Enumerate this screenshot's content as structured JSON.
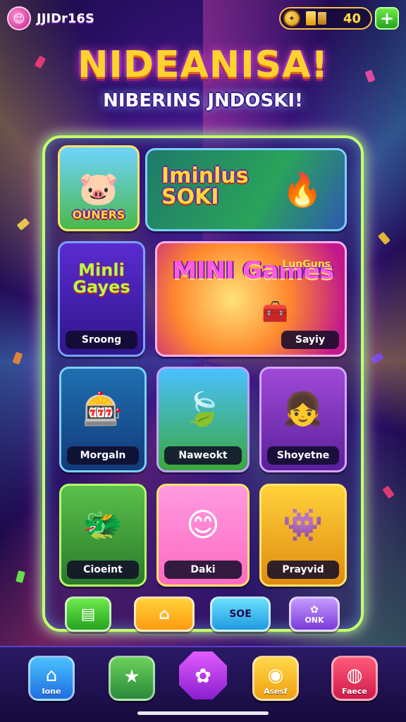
{
  "app": {
    "name": "JJIDr16S",
    "avatar_icon": "smiley-icon"
  },
  "currency": {
    "value": "40",
    "add_icon": "+"
  },
  "title": "NIDEANISA!",
  "subtitle": "NIBERINS JNDOSKI!",
  "tiles": [
    {
      "id": "tile-1",
      "heading": "OUNERS",
      "label": ""
    },
    {
      "id": "tile-2",
      "heading": "Iminlus SOKI",
      "label": ""
    },
    {
      "id": "tile-3",
      "heading": "Minli Gayes",
      "label": "Sroong"
    },
    {
      "id": "tile-4",
      "heading": "MINI Games",
      "label": "Sayiy",
      "badge": "LunGuns"
    },
    {
      "id": "tile-5",
      "heading": "",
      "label": "Morgaln"
    },
    {
      "id": "tile-6",
      "heading": "",
      "label": "Naweokt"
    },
    {
      "id": "tile-7",
      "heading": "",
      "label": "Shoyetne"
    },
    {
      "id": "tile-8",
      "heading": "",
      "label": "Cioeint"
    },
    {
      "id": "tile-9",
      "heading": "",
      "label": "Daki"
    },
    {
      "id": "tile-10",
      "heading": "",
      "label": "Prayvid"
    }
  ],
  "actions": [
    {
      "label": "",
      "icon": "store-icon",
      "color": "#3fd04a"
    },
    {
      "label": "",
      "icon": "house-icon",
      "color": "#ffb31a"
    },
    {
      "label": "SOE",
      "icon": "",
      "color": "#35c6ff"
    },
    {
      "label": "ONK",
      "icon": "shell-icon",
      "color": "#a86bff"
    }
  ],
  "nav": [
    {
      "label": "Ione",
      "icon": "home-icon",
      "color": "#2fa0ff"
    },
    {
      "label": "",
      "icon": "star-icon",
      "color": "#3aa84a"
    },
    {
      "label": "",
      "icon": "flower-icon",
      "color": "#c23cf0"
    },
    {
      "label": "Asesf",
      "icon": "chat-icon",
      "color": "#ffbf1a"
    },
    {
      "label": "Faece",
      "icon": "record-icon",
      "color": "#f0305a"
    }
  ]
}
